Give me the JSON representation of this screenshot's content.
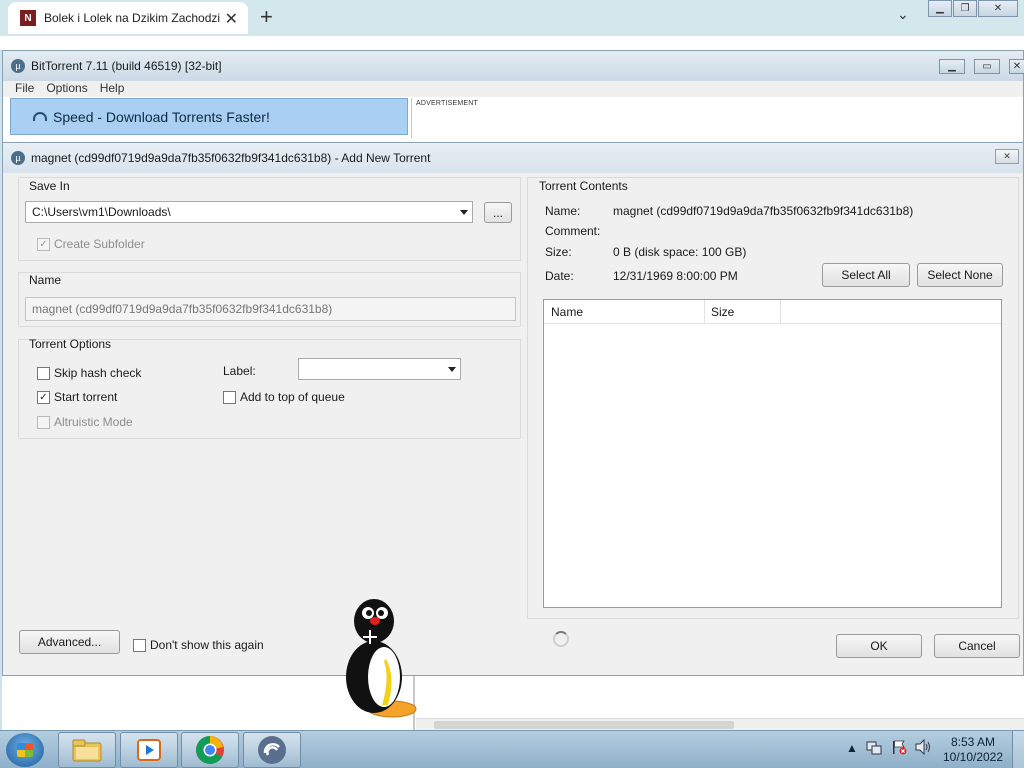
{
  "browser": {
    "tab_title": "Bolek i Lolek na Dzikim Zachodzie",
    "new_tab_symbol": "+",
    "favicon_letter": "N"
  },
  "bittorrent": {
    "window_title": "BitTorrent 7.11  (build 46519) [32-bit]",
    "menu": [
      "File",
      "Options",
      "Help"
    ],
    "speed_banner": "Speed - Download Torrents Faster!",
    "advertisement_label": "ADVERTISEMENT"
  },
  "dialog": {
    "title": "magnet (cd99df0719d9a9da7fb35f0632fb9f341dc631b8) - Add New Torrent",
    "save_in": {
      "label": "Save In",
      "path": "C:\\Users\\vm1\\Downloads\\",
      "browse_label": "...",
      "create_subfolder": "Create Subfolder"
    },
    "name_section": {
      "label": "Name",
      "value": "magnet (cd99df0719d9a9da7fb35f0632fb9f341dc631b8)"
    },
    "torrent_options": {
      "label": "Torrent Options",
      "skip_hash_check": "Skip hash check",
      "start_torrent": "Start torrent",
      "altruistic_mode": "Altruistic Mode",
      "label_field": "Label:",
      "add_to_top": "Add to top of queue"
    },
    "torrent_contents": {
      "label": "Torrent Contents",
      "name_key": "Name:",
      "name_value": "magnet (cd99df0719d9a9da7fb35f0632fb9f341dc631b8)",
      "comment_key": "Comment:",
      "comment_value": "",
      "size_key": "Size:",
      "size_value": "0 B (disk space: 100 GB)",
      "date_key": "Date:",
      "date_value": "12/31/1969 8:00:00 PM",
      "select_all": "Select All",
      "select_none": "Select None",
      "columns": [
        "Name",
        "Size"
      ]
    },
    "advanced_button": "Advanced...",
    "dont_show_again": "Don't show this again",
    "ok_button": "OK",
    "cancel_button": "Cancel"
  },
  "taskbar": {
    "time": "8:53 AM",
    "date": "10/10/2022"
  }
}
